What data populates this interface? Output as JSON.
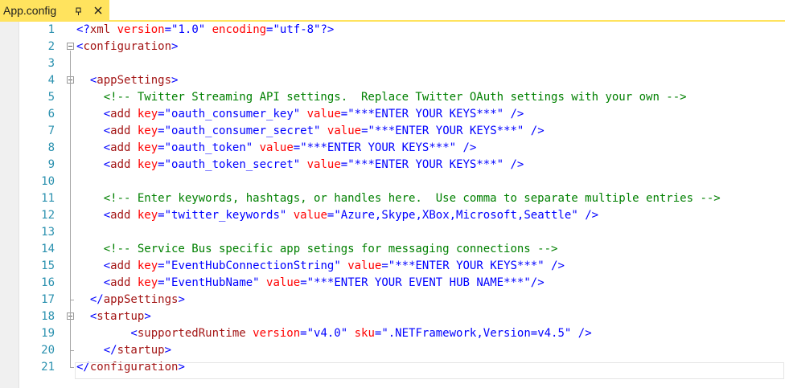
{
  "tab": {
    "title": "App.config"
  },
  "lines": [
    {
      "n": "1",
      "segs": [
        [
          "p",
          "<?"
        ],
        [
          "t",
          "xml"
        ],
        [
          "a",
          " version"
        ],
        [
          "p",
          "="
        ],
        [
          "v",
          "\"1.0\""
        ],
        [
          "a",
          " encoding"
        ],
        [
          "p",
          "="
        ],
        [
          "v",
          "\"utf-8\""
        ],
        [
          "p",
          "?>"
        ]
      ]
    },
    {
      "n": "2",
      "segs": [
        [
          "p",
          "<"
        ],
        [
          "t",
          "configuration"
        ],
        [
          "p",
          ">"
        ]
      ]
    },
    {
      "n": "3",
      "segs": []
    },
    {
      "n": "4",
      "segs": [
        [
          "p",
          "  <"
        ],
        [
          "t",
          "appSettings"
        ],
        [
          "p",
          ">"
        ]
      ]
    },
    {
      "n": "5",
      "segs": [
        [
          "c",
          "    <!-- Twitter Streaming API settings.  Replace Twitter OAuth settings with your own -->"
        ]
      ]
    },
    {
      "n": "6",
      "segs": [
        [
          "p",
          "    <"
        ],
        [
          "t",
          "add"
        ],
        [
          "a",
          " key"
        ],
        [
          "p",
          "="
        ],
        [
          "v",
          "\"oauth_consumer_key\""
        ],
        [
          "a",
          " value"
        ],
        [
          "p",
          "="
        ],
        [
          "v",
          "\"***ENTER YOUR KEYS***\""
        ],
        [
          "p",
          " />"
        ]
      ]
    },
    {
      "n": "7",
      "segs": [
        [
          "p",
          "    <"
        ],
        [
          "t",
          "add"
        ],
        [
          "a",
          " key"
        ],
        [
          "p",
          "="
        ],
        [
          "v",
          "\"oauth_consumer_secret\""
        ],
        [
          "a",
          " value"
        ],
        [
          "p",
          "="
        ],
        [
          "v",
          "\"***ENTER YOUR KEYS***\""
        ],
        [
          "p",
          " />"
        ]
      ]
    },
    {
      "n": "8",
      "segs": [
        [
          "p",
          "    <"
        ],
        [
          "t",
          "add"
        ],
        [
          "a",
          " key"
        ],
        [
          "p",
          "="
        ],
        [
          "v",
          "\"oauth_token\""
        ],
        [
          "a",
          " value"
        ],
        [
          "p",
          "="
        ],
        [
          "v",
          "\"***ENTER YOUR KEYS***\""
        ],
        [
          "p",
          " />"
        ]
      ]
    },
    {
      "n": "9",
      "segs": [
        [
          "p",
          "    <"
        ],
        [
          "t",
          "add"
        ],
        [
          "a",
          " key"
        ],
        [
          "p",
          "="
        ],
        [
          "v",
          "\"oauth_token_secret\""
        ],
        [
          "a",
          " value"
        ],
        [
          "p",
          "="
        ],
        [
          "v",
          "\"***ENTER YOUR KEYS***\""
        ],
        [
          "p",
          " />"
        ]
      ]
    },
    {
      "n": "10",
      "segs": []
    },
    {
      "n": "11",
      "segs": [
        [
          "c",
          "    <!-- Enter keywords, hashtags, or handles here.  Use comma to separate multiple entries -->"
        ]
      ]
    },
    {
      "n": "12",
      "segs": [
        [
          "p",
          "    <"
        ],
        [
          "t",
          "add"
        ],
        [
          "a",
          " key"
        ],
        [
          "p",
          "="
        ],
        [
          "v",
          "\"twitter_keywords\""
        ],
        [
          "a",
          " value"
        ],
        [
          "p",
          "="
        ],
        [
          "v",
          "\"Azure,Skype,XBox,Microsoft,Seattle\""
        ],
        [
          "p",
          " />"
        ]
      ]
    },
    {
      "n": "13",
      "segs": []
    },
    {
      "n": "14",
      "segs": [
        [
          "c",
          "    <!-- Service Bus specific app setings for messaging connections -->"
        ]
      ]
    },
    {
      "n": "15",
      "segs": [
        [
          "p",
          "    <"
        ],
        [
          "t",
          "add"
        ],
        [
          "a",
          " key"
        ],
        [
          "p",
          "="
        ],
        [
          "v",
          "\"EventHubConnectionString\""
        ],
        [
          "a",
          " value"
        ],
        [
          "p",
          "="
        ],
        [
          "v",
          "\"***ENTER YOUR KEYS***\""
        ],
        [
          "p",
          " />"
        ]
      ]
    },
    {
      "n": "16",
      "segs": [
        [
          "p",
          "    <"
        ],
        [
          "t",
          "add"
        ],
        [
          "a",
          " key"
        ],
        [
          "p",
          "="
        ],
        [
          "v",
          "\"EventHubName\""
        ],
        [
          "a",
          " value"
        ],
        [
          "p",
          "="
        ],
        [
          "v",
          "\"***ENTER YOUR EVENT HUB NAME***\""
        ],
        [
          "p",
          "/>"
        ]
      ]
    },
    {
      "n": "17",
      "segs": [
        [
          "p",
          "  </"
        ],
        [
          "t",
          "appSettings"
        ],
        [
          "p",
          ">"
        ]
      ]
    },
    {
      "n": "18",
      "segs": [
        [
          "p",
          "  <"
        ],
        [
          "t",
          "startup"
        ],
        [
          "p",
          ">"
        ]
      ]
    },
    {
      "n": "19",
      "segs": [
        [
          "p",
          "        <"
        ],
        [
          "t",
          "supportedRuntime"
        ],
        [
          "a",
          " version"
        ],
        [
          "p",
          "="
        ],
        [
          "v",
          "\"v4.0\""
        ],
        [
          "a",
          " sku"
        ],
        [
          "p",
          "="
        ],
        [
          "v",
          "\".NETFramework,Version=v4.5\""
        ],
        [
          "p",
          " />"
        ]
      ]
    },
    {
      "n": "20",
      "segs": [
        [
          "p",
          "    </"
        ],
        [
          "t",
          "startup"
        ],
        [
          "p",
          ">"
        ]
      ]
    },
    {
      "n": "21",
      "segs": [
        [
          "p",
          "</"
        ],
        [
          "t",
          "configuration"
        ],
        [
          "p",
          ">"
        ]
      ]
    }
  ],
  "folds": [
    "2",
    "4",
    "18"
  ],
  "colors": {
    "tab_active": "#ffe35e",
    "line_number": "#2b91af",
    "element": "#a31515",
    "attribute": "#ff0000",
    "value": "#0000ff",
    "comment": "#008000"
  }
}
